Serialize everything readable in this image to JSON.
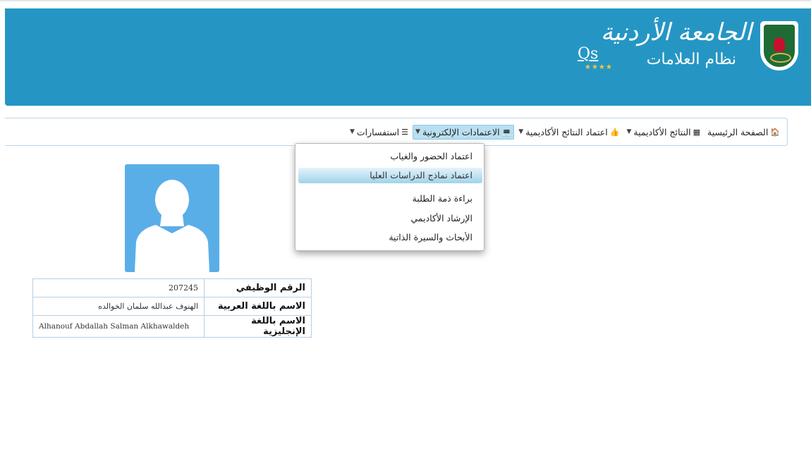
{
  "header": {
    "university_name": "الجامعة الأردنية",
    "system_name": "نظام العلامات",
    "qs_logo": "Qs",
    "qs_stars": "★★★★",
    "colors": {
      "banner": "#2596c4",
      "avatar": "#5aaee8",
      "active_nav": "#b9dff0"
    }
  },
  "nav": {
    "items": [
      {
        "label": "الصفحة الرئيسية",
        "icon": "home-icon",
        "glyph": "⌂",
        "caret": ""
      },
      {
        "label": "النتائج الأكاديمية",
        "icon": "table-icon",
        "glyph": "▦",
        "caret": "▾"
      },
      {
        "label": "اعتماد النتائج الأكاديمية",
        "icon": "thumbs-up-icon",
        "glyph": "👍",
        "caret": "▾"
      },
      {
        "label": "الاعتمادات الإلكترونية",
        "icon": "laptop-icon",
        "glyph": "💻",
        "caret": "▾"
      },
      {
        "label": "استفسارات",
        "icon": "list-icon",
        "glyph": "☰",
        "caret": "▾"
      }
    ]
  },
  "dropdown": {
    "items": [
      "اعتماد الحضور والغياب",
      "اعتماد نماذج الدراسات العليا",
      "براءة ذمة الطلبة",
      "الإرشاد الأكاديمي",
      "الأبحاث والسيرة الذاتية"
    ]
  },
  "profile": {
    "avatar_icon": "user-silhouette-icon",
    "rows": [
      {
        "label": "الرقم الوظيفي",
        "value": "207245"
      },
      {
        "label": "الاسم باللغة العربية",
        "value": "الهنوف عبدالله سلمان الخوالده"
      },
      {
        "label": "الاسم باللغة الإنجليزية",
        "value": "Alhanouf Abdallah Salman Alkhawaldeh"
      }
    ]
  }
}
